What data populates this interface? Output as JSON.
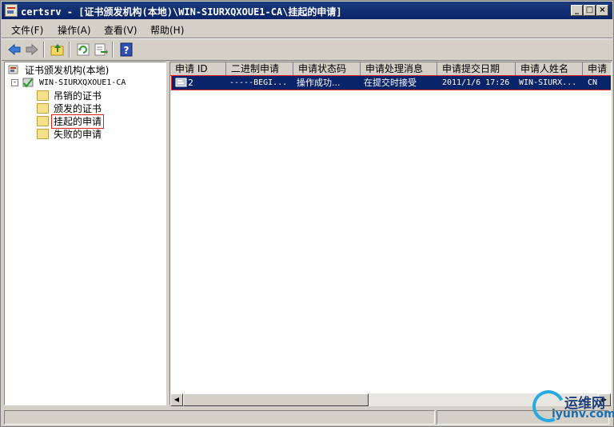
{
  "window": {
    "title": "certsrv - [证书颁发机构(本地)\\WIN-SIURXQXOUE1-CA\\挂起的申请]",
    "minimize": "_",
    "maximize": "□",
    "close": "×"
  },
  "menu": [
    "文件(F)",
    "操作(A)",
    "查看(V)",
    "帮助(H)"
  ],
  "toolbar": {
    "icons": [
      "back-arrow-icon",
      "forward-arrow-icon",
      "up-folder-icon",
      "refresh-icon",
      "export-list-icon",
      "help-icon"
    ]
  },
  "tree": {
    "root": "证书颁发机构(本地)",
    "ca": "WIN-SIURXQXOUE1-CA",
    "expander_root": "-",
    "children": [
      "吊销的证书",
      "颁发的证书",
      "挂起的申请",
      "失败的申请"
    ],
    "selected": "挂起的申请"
  },
  "list": {
    "columns": [
      "申请 ID",
      "二进制申请",
      "申请状态码",
      "申请处理消息",
      "申请提交日期",
      "申请人姓名",
      "申请"
    ],
    "rows": [
      {
        "id": "2",
        "binary": "-----BEGI...",
        "status": "操作成功...",
        "message": "在提交时接受",
        "date": "2011/1/6 17:26",
        "requester": "WIN-SIURX...",
        "extra": "CN"
      }
    ]
  },
  "scrollbar": {
    "left": "◀",
    "right": "▶"
  },
  "watermark": {
    "top": "运维网",
    "bottom": "iyunv.com"
  },
  "colors": {
    "selection": "#0a246a",
    "highlight_outline": "#e02020",
    "titlebar": "#0a246a"
  }
}
